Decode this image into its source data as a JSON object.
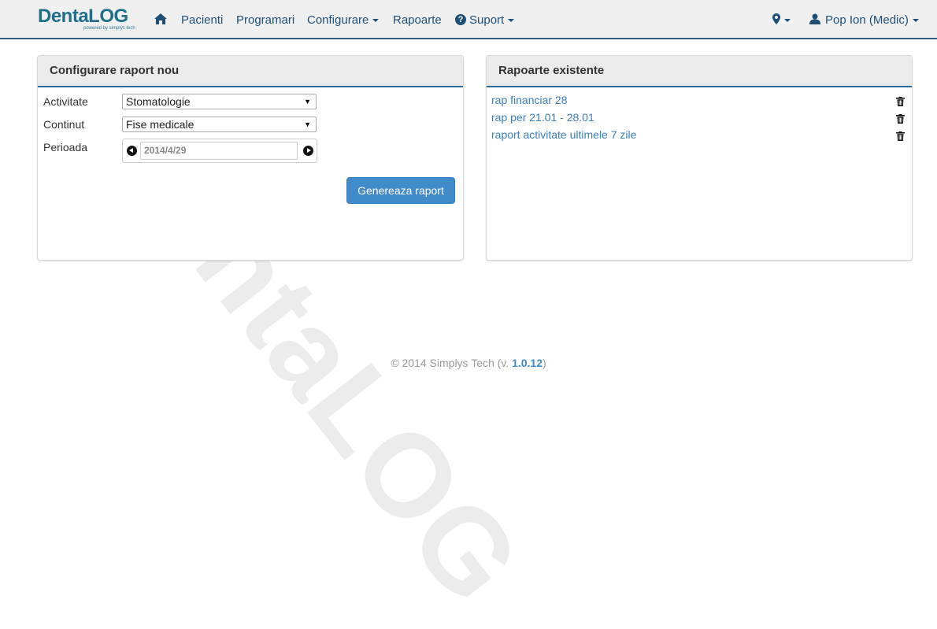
{
  "brand": {
    "name": "DentaLOG",
    "tagline": "powered by simplys tech"
  },
  "navbar": {
    "home_icon": "home-icon",
    "items": [
      "Pacienti",
      "Programari",
      "Configurare",
      "Rapoarte",
      "Suport"
    ],
    "location_icon": "map-marker-icon",
    "user": "Pop Ion (Medic)",
    "user_icon": "user-icon"
  },
  "new_report": {
    "title": "Configurare raport nou",
    "activity_label": "Activitate",
    "activity_value": "Stomatologie",
    "content_label": "Continut",
    "content_value": "Fise medicale",
    "period_label": "Perioada",
    "period_value": "2014/4/29",
    "generate_button": "Genereaza raport"
  },
  "existing_reports": {
    "title": "Rapoarte existente",
    "items": [
      "rap financiar 28",
      "rap per 21.01 - 28.01",
      "raport activitate ultimele 7 zile"
    ]
  },
  "footer": {
    "prefix": "© 2014 Simplys Tech (v. ",
    "version": "1.0.12",
    "suffix": ")"
  },
  "colors": {
    "accent": "#428bca",
    "nav_text": "#1e4f78",
    "link": "#3a7fbf"
  }
}
